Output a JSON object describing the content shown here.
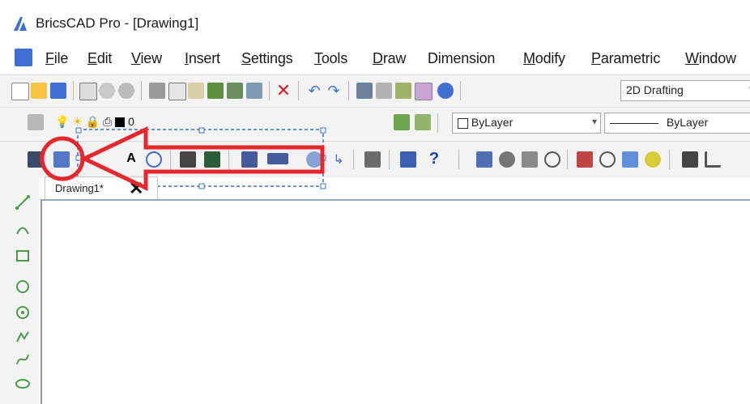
{
  "window": {
    "title": "BricsCAD Pro - [Drawing1]"
  },
  "menu": {
    "items": [
      {
        "accel": "F",
        "rest": "ile"
      },
      {
        "accel": "E",
        "rest": "dit"
      },
      {
        "accel": "V",
        "rest": "iew"
      },
      {
        "accel": "I",
        "rest": "nsert"
      },
      {
        "accel": "S",
        "rest": "ettings"
      },
      {
        "accel": "T",
        "rest": "ools"
      },
      {
        "accel": "D",
        "rest": "raw"
      },
      {
        "accel": "",
        "rest": "Dimension"
      },
      {
        "accel": "M",
        "rest": "odify"
      },
      {
        "accel": "P",
        "rest": "arametric"
      },
      {
        "accel": "W",
        "rest": "indow"
      }
    ]
  },
  "toolbar1": {
    "workspace_value": "2D Drafting"
  },
  "toolbar2": {
    "layer_value": "0",
    "color_value": "ByLayer",
    "linetype_value": "ByLayer"
  },
  "toolbar3": {
    "help_glyph": "?"
  },
  "tab": {
    "label": "Drawing1",
    "modified_mark": "*",
    "close_glyph": "✕"
  },
  "colors": {
    "accent": "#e8262c",
    "toolbar_bg": "#f3f3f3",
    "logo_blue": "#3f6fd1"
  }
}
